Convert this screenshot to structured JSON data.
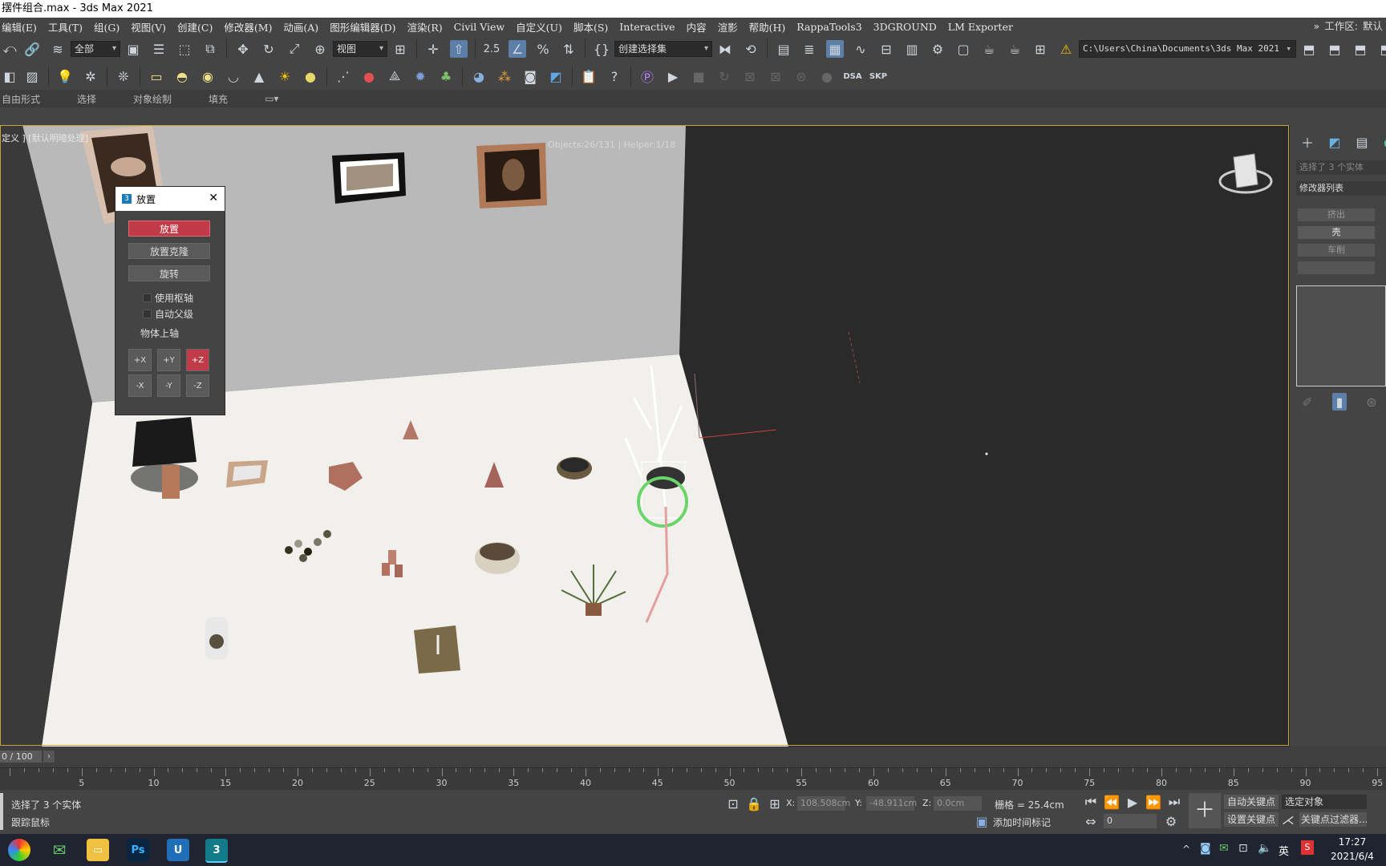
{
  "window": {
    "title": "摆件组合.max - 3ds Max 2021"
  },
  "menu": [
    "编辑(E)",
    "工具(T)",
    "组(G)",
    "视图(V)",
    "创建(C)",
    "修改器(M)",
    "动画(A)",
    "图形编辑器(D)",
    "渲染(R)",
    "Civil View",
    "自定义(U)",
    "脚本(S)",
    "Interactive",
    "内容",
    "渲影",
    "帮助(H)",
    "RappaTools3",
    "3DGROUND",
    "LM Exporter"
  ],
  "workspace": {
    "chevron": "»",
    "label": "工作区:",
    "value": "默认"
  },
  "toolbar": {
    "filter_dropdown": "全部",
    "view_dropdown": "视图",
    "snap_label": "2.5",
    "selection_set_dropdown": "创建选择集",
    "project_path": "C:\\Users\\China\\Documents\\3ds Max 2021",
    "dsa_label": "DSA",
    "skp_label": "SKP"
  },
  "ribbon_tabs": [
    "自由形式",
    "选择",
    "对象绘制",
    "填充"
  ],
  "viewport": {
    "label": "定义 ] [默认明暗处理]",
    "stats": "Objects:26/131 | Helper:1/18"
  },
  "dialog": {
    "title": "放置",
    "btn_place": "放置",
    "btn_place_clone": "放置克隆",
    "btn_rotate": "旋转",
    "chk_pivot": "使用枢轴",
    "chk_auto_parent": "自动父级",
    "axis_label": "物体上轴",
    "axes": [
      "+X",
      "+Y",
      "+Z",
      "-X",
      "-Y",
      "-Z"
    ],
    "active_axis": "+Z"
  },
  "command_panel": {
    "selection_info": "选择了 3 个实体",
    "modifier_list": "修改器列表",
    "btn_extrude": "挤出",
    "btn_shell": "壳",
    "btn_lathe": "车削"
  },
  "timeline": {
    "frame_field": "0 / 100",
    "ticks": [
      5,
      10,
      15,
      20,
      25,
      30,
      35,
      40,
      45,
      50,
      55,
      60,
      65,
      70,
      75,
      80,
      85,
      90,
      95
    ]
  },
  "status": {
    "selected": "选择了 3 个实体",
    "track_mouse": "跟踪鼠标",
    "x_label": "X:",
    "x_value": "108.508cm",
    "y_label": "Y:",
    "y_value": "-48.911cm",
    "z_label": "Z:",
    "z_value": "0.0cm",
    "grid": "栅格 = 25.4cm",
    "add_time_tag": "添加时间标记",
    "auto_key": "自动关键点",
    "selected_object": "选定对象",
    "set_key": "设置关键点",
    "key_filter": "关键点过滤器...",
    "frame_value": "0"
  },
  "taskbar": {
    "ime": "英",
    "time": "17:27",
    "date": "2021/6/4"
  }
}
